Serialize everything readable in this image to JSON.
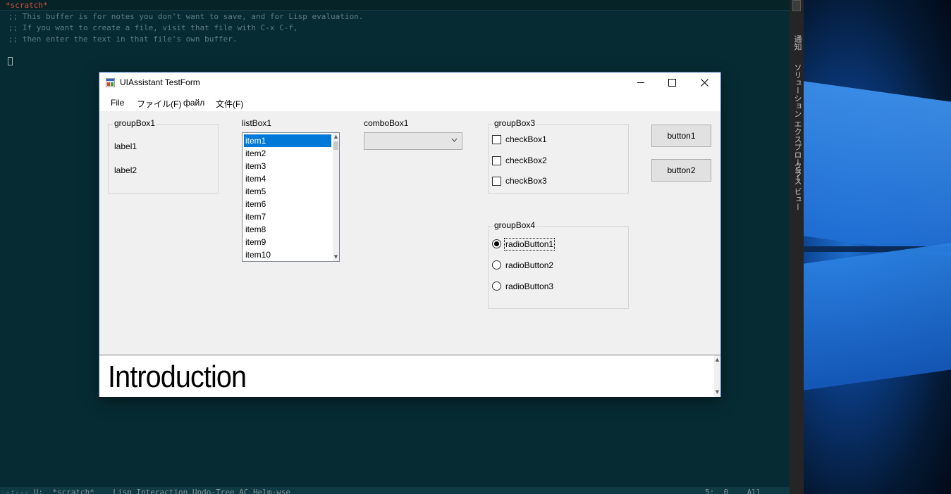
{
  "emacs": {
    "buffer_name": "*scratch*",
    "lines": [
      ";; This buffer is for notes you don't want to save, and for Lisp evaluation.",
      ";; If you want to create a file, visit that file with C-x C-f,",
      ";; then enter the text in that file's own buffer."
    ],
    "modeline_left": "-:--- U:  *scratch*    Lisp Interaction Undo-Tree AC Helm-wse",
    "modeline_right": "5:  0    All"
  },
  "side_strip": {
    "labels": [
      "通知",
      "ソリューション エクスプローラー",
      "クラス ビュー"
    ]
  },
  "window": {
    "title": "UIAssistant TestForm",
    "controls": {
      "minimize": "—",
      "maximize": "☐",
      "close": "✕"
    }
  },
  "menu": {
    "items": [
      "File",
      "ファイル(F)",
      "файл",
      "文件(F)"
    ]
  },
  "groupBox1": {
    "title": "groupBox1",
    "label1": "label1",
    "label2": "label2"
  },
  "listBox1": {
    "label": "listBox1",
    "items": [
      "item1",
      "item2",
      "item3",
      "item4",
      "item5",
      "item6",
      "item7",
      "item8",
      "item9",
      "item10"
    ],
    "selected_index": 0
  },
  "comboBox1": {
    "label": "comboBox1",
    "value": ""
  },
  "groupBox3": {
    "title": "groupBox3",
    "checkboxes": [
      {
        "label": "checkBox1",
        "checked": false
      },
      {
        "label": "checkBox2",
        "checked": false
      },
      {
        "label": "checkBox3",
        "checked": false
      }
    ]
  },
  "groupBox4": {
    "title": "groupBox4",
    "radios": [
      {
        "label": "radioButton1",
        "checked": true
      },
      {
        "label": "radioButton2",
        "checked": false
      },
      {
        "label": "radioButton3",
        "checked": false
      }
    ]
  },
  "buttons": {
    "button1": "button1",
    "button2": "button2"
  },
  "richtext": {
    "text": "Introduction"
  },
  "colors": {
    "emacs_bg": "#072b33",
    "form_bg": "#f0f0f0",
    "selection": "#0078d7",
    "buffer_name": "#d4523f"
  }
}
